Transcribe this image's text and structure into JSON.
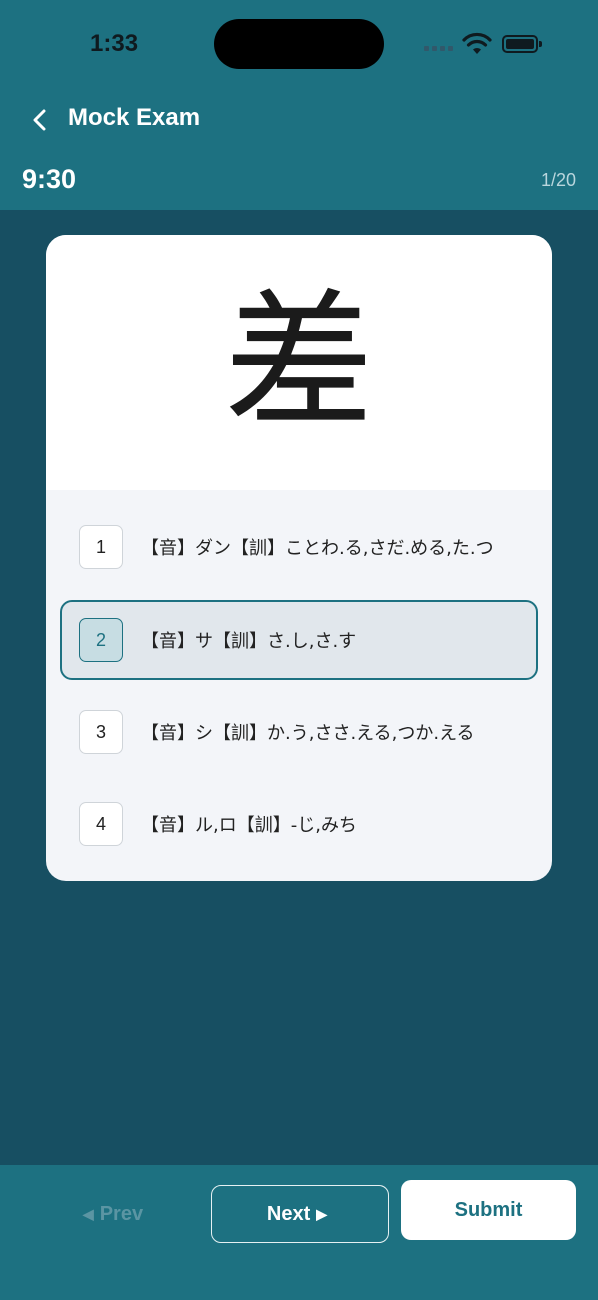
{
  "status_bar": {
    "time": "1:33"
  },
  "nav": {
    "title": "Mock Exam",
    "back_icon": "chevron-left-icon"
  },
  "exam": {
    "timer": "9:30",
    "progress": "1/20"
  },
  "question": {
    "kanji": "差"
  },
  "options": [
    {
      "number": "1",
      "text": "【音】ダン【訓】ことわ.る,さだ.める,た.つ",
      "selected": false
    },
    {
      "number": "2",
      "text": "【音】サ【訓】さ.し,さ.す",
      "selected": true
    },
    {
      "number": "3",
      "text": "【音】シ【訓】か.う,ささ.える,つか.える",
      "selected": false
    },
    {
      "number": "4",
      "text": "【音】ル,ロ【訓】-じ,みち",
      "selected": false
    }
  ],
  "footer": {
    "prev_label": "Prev",
    "prev_arrow": "◀",
    "next_label": "Next",
    "next_arrow": "▶",
    "submit_label": "Submit"
  },
  "colors": {
    "header": "#1d7181",
    "background": "#174f62",
    "accent": "#1d7181",
    "selected_option_bg": "#e1e7ec"
  }
}
